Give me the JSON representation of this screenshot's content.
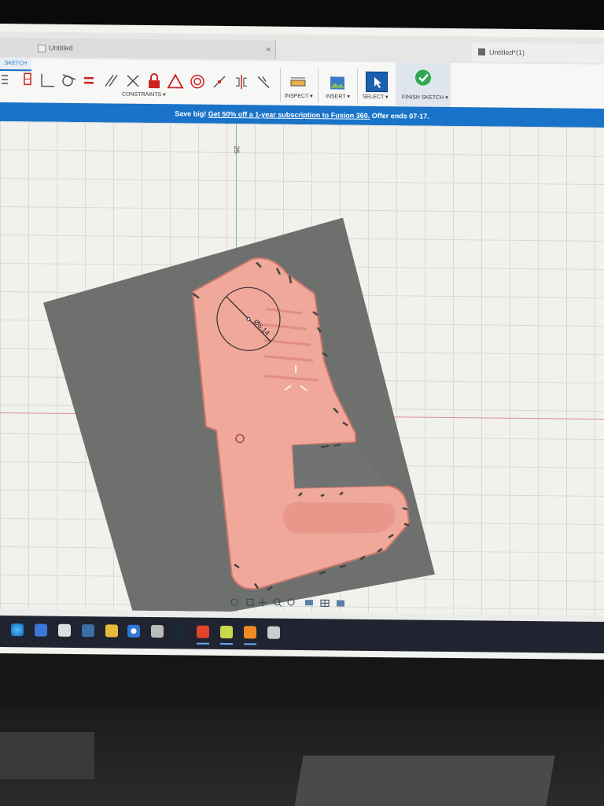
{
  "tabs": {
    "left_title": "Untitled",
    "right_title": "Untitled*(1)",
    "close_glyph": "×"
  },
  "toolbar": {
    "workspace_tab": "SKETCH",
    "constraints_label": "CONSTRAINTS ▾",
    "inspect_label": "INSPECT ▾",
    "insert_label": "INSERT ▾",
    "select_label": "SELECT ▾",
    "finish_label": "FINISH SKETCH ▾"
  },
  "banner": {
    "prefix": "Save big! ",
    "link": "Get 50% off a 1-year subscription to Fusion 360.",
    "suffix": " Offer ends 07-17."
  },
  "canvas": {
    "axis_label": "25",
    "dimension_text": "Ø6.14",
    "accent_color": "#1973c8",
    "part_color": "#f0a89a",
    "backdrop_color": "#6e706e"
  },
  "taskbar": {
    "icons": [
      "edge-icon",
      "mail-icon",
      "store-icon",
      "app-icon",
      "folder-icon",
      "chrome-icon",
      "tool-icon",
      "steam-icon",
      "gear-app-icon",
      "notes-icon",
      "fusion-icon",
      "printer-icon"
    ]
  }
}
